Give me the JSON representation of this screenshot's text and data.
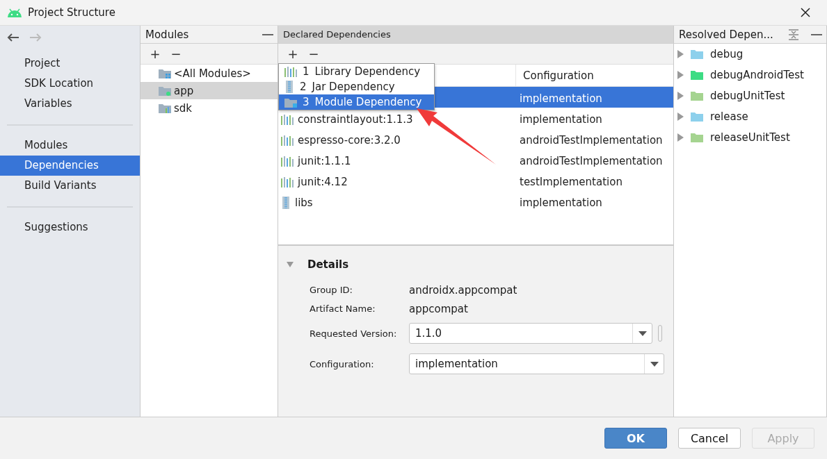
{
  "window": {
    "title": "Project Structure"
  },
  "sidebar": {
    "groups": [
      [
        {
          "label": "Project",
          "selected": false
        },
        {
          "label": "SDK Location",
          "selected": false
        },
        {
          "label": "Variables",
          "selected": false
        }
      ],
      [
        {
          "label": "Modules",
          "selected": false
        },
        {
          "label": "Dependencies",
          "selected": true
        },
        {
          "label": "Build Variants",
          "selected": false
        }
      ],
      [
        {
          "label": "Suggestions",
          "selected": false
        }
      ]
    ]
  },
  "modules": {
    "title": "Modules",
    "toolbar": [
      "+",
      "−"
    ],
    "items": [
      {
        "label": "<All Modules>",
        "kind": "all",
        "selected": false
      },
      {
        "label": "app",
        "kind": "app",
        "selected": true
      },
      {
        "label": "sdk",
        "kind": "lib",
        "selected": false
      }
    ]
  },
  "declared": {
    "title": "Declared Dependencies",
    "toolbar": [
      "+",
      "−"
    ],
    "header": {
      "configuration": "Configuration"
    },
    "rows": [
      {
        "configuration": "implementation",
        "selected": true
      },
      {
        "name": "constraintlayout:1.1.3",
        "configuration": "implementation",
        "selected": false,
        "kind": "library"
      },
      {
        "name": "espresso-core:3.2.0",
        "configuration": "androidTestImplementation",
        "selected": false,
        "kind": "library"
      },
      {
        "name": "junit:1.1.1",
        "configuration": "androidTestImplementation",
        "selected": false,
        "kind": "library"
      },
      {
        "name": "junit:4.12",
        "configuration": "testImplementation",
        "selected": false,
        "kind": "library"
      },
      {
        "name": "libs",
        "configuration": "implementation",
        "selected": false,
        "kind": "jar"
      }
    ],
    "add_menu": [
      {
        "number": "1",
        "label": "Library Dependency",
        "kind": "library",
        "selected": false
      },
      {
        "number": "2",
        "label": "Jar Dependency",
        "kind": "jar",
        "selected": false
      },
      {
        "number": "3",
        "label": "Module Dependency",
        "kind": "module",
        "selected": true
      }
    ],
    "details": {
      "title": "Details",
      "expanded": true,
      "group_id": {
        "label": "Group ID:",
        "value": "androidx.appcompat"
      },
      "artifact_name": {
        "label": "Artifact Name:",
        "value": "appcompat"
      },
      "requested_version": {
        "label": "Requested Version:",
        "value": "1.1.0"
      },
      "configuration": {
        "label": "Configuration:",
        "value": "implementation"
      }
    }
  },
  "resolved": {
    "title": "Resolved Depen...",
    "items": [
      {
        "label": "debug",
        "color": "#8dd0ec"
      },
      {
        "label": "debugAndroidTest",
        "color": "#3ddc84"
      },
      {
        "label": "debugUnitTest",
        "color": "#a5d490"
      },
      {
        "label": "release",
        "color": "#8dd0ec"
      },
      {
        "label": "releaseUnitTest",
        "color": "#a5d490"
      }
    ]
  },
  "buttons": [
    {
      "label": "OK",
      "kind": "primary"
    },
    {
      "label": "Cancel",
      "kind": "normal"
    },
    {
      "label": "Apply",
      "kind": "disabled"
    }
  ]
}
